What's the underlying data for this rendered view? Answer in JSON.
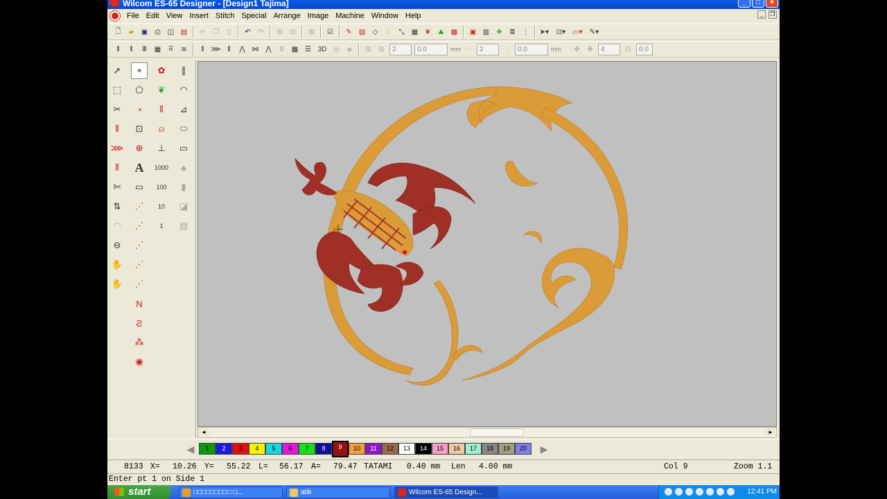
{
  "window": {
    "title": "Wilcom ES-65 Designer - [Design1          Tajima]"
  },
  "menu": [
    "File",
    "Edit",
    "View",
    "Insert",
    "Stitch",
    "Special",
    "Arrange",
    "Image",
    "Machine",
    "Window",
    "Help"
  ],
  "toolbar2": {
    "spin1_value": "2",
    "spin2_value": "0.0",
    "unit1": "mm",
    "spin3_value": "2",
    "spin4_value": "0.0",
    "unit2": "mm",
    "spin5_value": "4",
    "spin6_value": "0.0",
    "label_3d": "3D"
  },
  "toolbox": {
    "text_tool_label": "A",
    "numbers": [
      "1000",
      "100",
      "10",
      "1"
    ]
  },
  "palette": {
    "swatches": [
      {
        "label": "1",
        "color": "#0c9a0c"
      },
      {
        "label": "2",
        "color": "#1a1ad8"
      },
      {
        "label": "3",
        "color": "#e01010"
      },
      {
        "label": "4",
        "color": "#f4f400"
      },
      {
        "label": "5",
        "color": "#18d8e0"
      },
      {
        "label": "6",
        "color": "#e018e0"
      },
      {
        "label": "7",
        "color": "#18e018"
      },
      {
        "label": "8",
        "color": "#10109a"
      },
      {
        "label": "9",
        "color": "#9a1010"
      },
      {
        "label": "10",
        "color": "#f0a040"
      },
      {
        "label": "11",
        "color": "#8a18c8"
      },
      {
        "label": "12",
        "color": "#9a6a4a"
      },
      {
        "label": "13",
        "color": "#ffffff"
      },
      {
        "label": "14",
        "color": "#000000"
      },
      {
        "label": "15",
        "color": "#f4a0c8"
      },
      {
        "label": "16",
        "color": "#f4c8a0"
      },
      {
        "label": "17",
        "color": "#a0f0d0"
      },
      {
        "label": "18",
        "color": "#888888"
      },
      {
        "label": "19",
        "color": "#a0a080"
      },
      {
        "label": "20",
        "color": "#8080e0"
      }
    ],
    "active_index": 8
  },
  "status": {
    "stitch_count": "8133",
    "x_label": "X=",
    "x_value": "10.26",
    "y_label": "Y=",
    "y_value": "55.22",
    "l_label": "L=",
    "l_value": "56.17",
    "a_label": "A=",
    "a_value": "79.47",
    "stitch_type": "TATAMI",
    "spacing": "0.40 mm",
    "len_label": "Len",
    "length": "4.00 mm",
    "color": "Col 9",
    "zoom": "Zoom 1.1",
    "prompt": "Enter pt 1 on Side 1"
  },
  "taskbar": {
    "start_label": "start",
    "tasks": [
      {
        "label": "□□□□□□□□□ □...",
        "icon_color": "#e8a020"
      },
      {
        "label": "atik",
        "icon_color": "#f0c860"
      },
      {
        "label": "Wilcom ES-65 Design...",
        "icon_color": "#d4261a"
      }
    ],
    "clock": "12:41 PM"
  },
  "colors": {
    "gold_thread": "#e2a43c",
    "red_thread": "#a8342a",
    "canvas_bg": "#c0c0c0"
  }
}
